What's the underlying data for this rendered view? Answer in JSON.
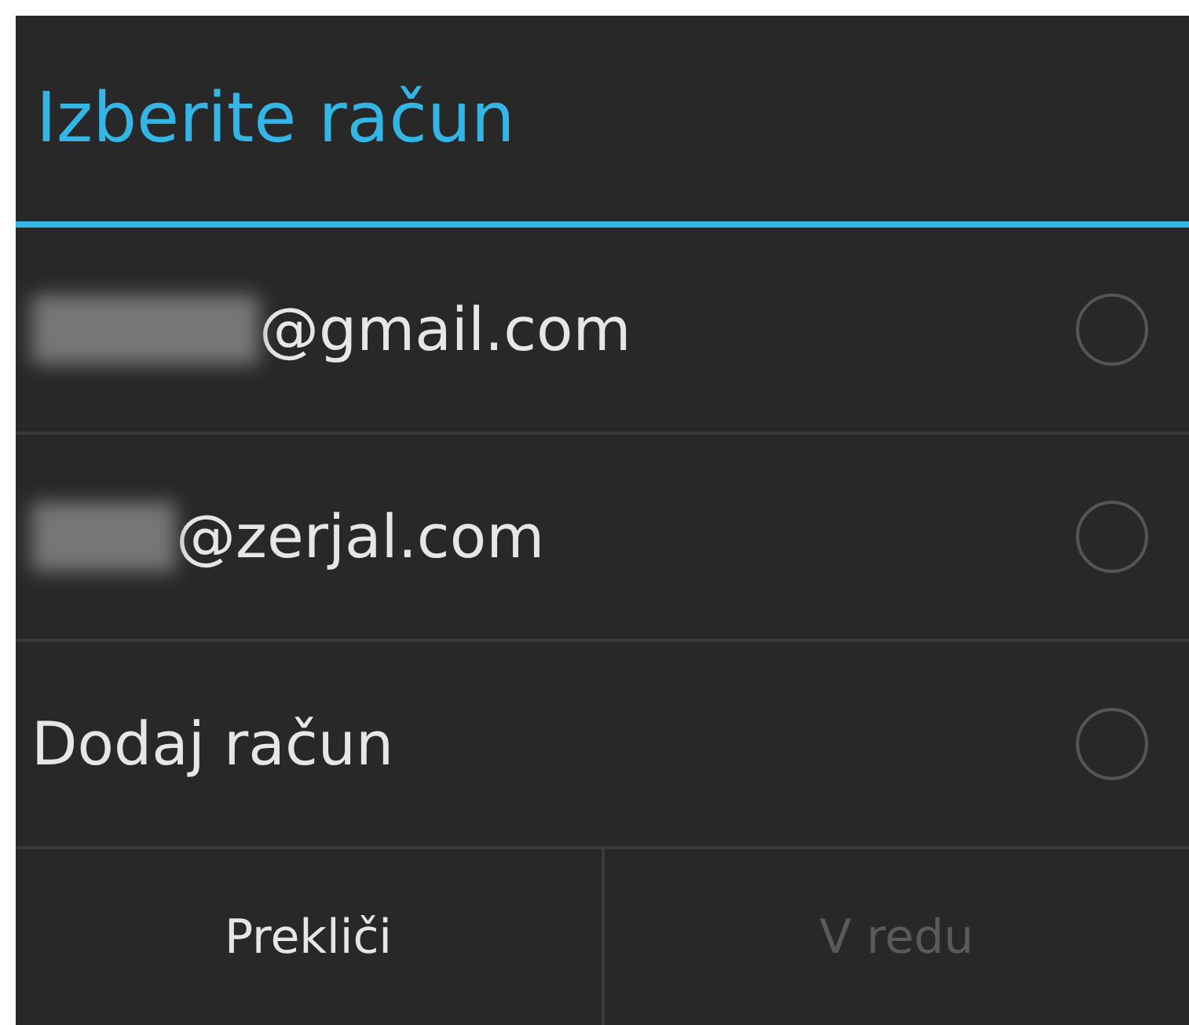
{
  "dialog": {
    "title": "Izberite račun"
  },
  "accounts": [
    {
      "label": "@gmail.com",
      "redacted": true,
      "selected": false
    },
    {
      "label": "@zerjal.com",
      "redacted": true,
      "selected": false
    },
    {
      "label": "Dodaj račun",
      "redacted": false,
      "selected": false
    }
  ],
  "buttons": [
    {
      "label": "Prekliči",
      "disabled": false
    },
    {
      "label": "V redu",
      "disabled": true
    }
  ]
}
